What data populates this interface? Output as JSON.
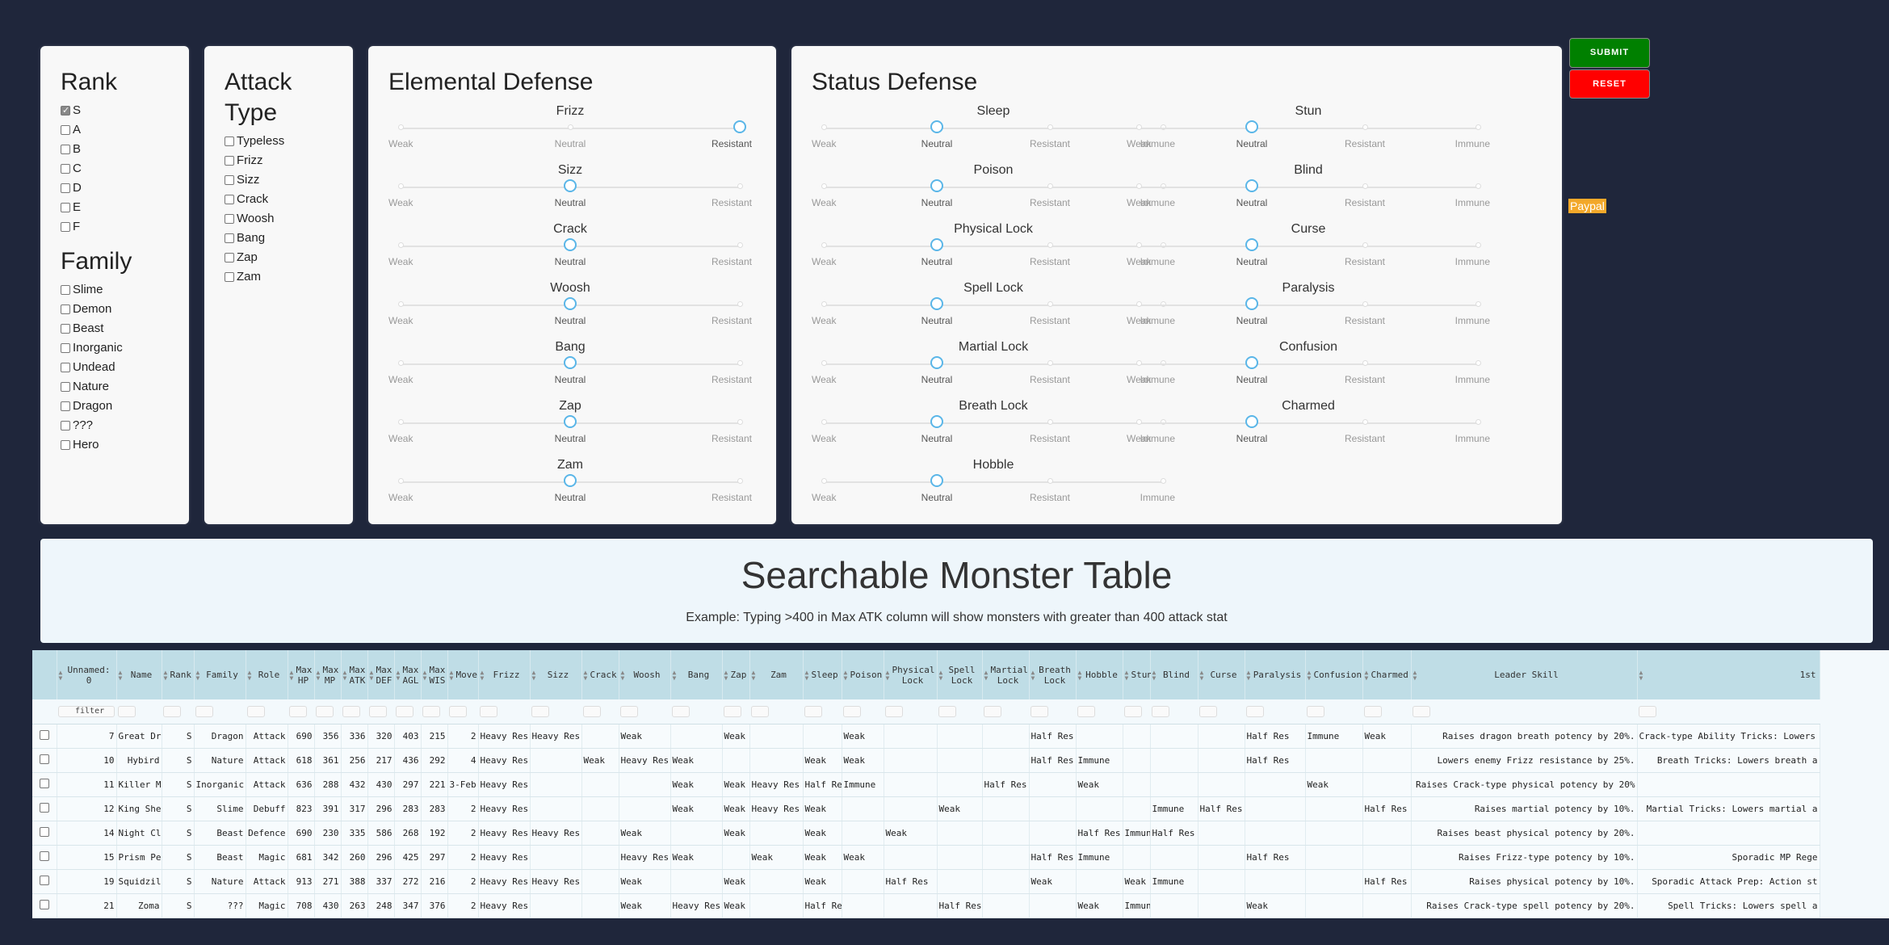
{
  "rank": {
    "title": "Rank",
    "options": [
      {
        "label": "S",
        "checked": true
      },
      {
        "label": "A",
        "checked": false
      },
      {
        "label": "B",
        "checked": false
      },
      {
        "label": "C",
        "checked": false
      },
      {
        "label": "D",
        "checked": false
      },
      {
        "label": "E",
        "checked": false
      },
      {
        "label": "F",
        "checked": false
      }
    ]
  },
  "family": {
    "title": "Family",
    "options": [
      "Slime",
      "Demon",
      "Beast",
      "Inorganic",
      "Undead",
      "Nature",
      "Dragon",
      "???",
      "Hero"
    ]
  },
  "attack_type": {
    "title_line1": "Attack",
    "title_line2": "Type",
    "options": [
      "Typeless",
      "Frizz",
      "Sizz",
      "Crack",
      "Woosh",
      "Bang",
      "Zap",
      "Zam"
    ]
  },
  "elemental_defense": {
    "title": "Elemental Defense",
    "levels": [
      "Weak",
      "Neutral",
      "Resistant"
    ],
    "sliders": [
      {
        "name": "Frizz",
        "value": "Resistant"
      },
      {
        "name": "Sizz",
        "value": "Neutral"
      },
      {
        "name": "Crack",
        "value": "Neutral"
      },
      {
        "name": "Woosh",
        "value": "Neutral"
      },
      {
        "name": "Bang",
        "value": "Neutral"
      },
      {
        "name": "Zap",
        "value": "Neutral"
      },
      {
        "name": "Zam",
        "value": "Neutral"
      }
    ]
  },
  "status_defense": {
    "title": "Status Defense",
    "levels": [
      "Weak",
      "Neutral",
      "Resistant",
      "Immune"
    ],
    "sliders": [
      {
        "name": "Sleep",
        "value": "Neutral"
      },
      {
        "name": "Stun",
        "value": "Neutral"
      },
      {
        "name": "Poison",
        "value": "Neutral"
      },
      {
        "name": "Blind",
        "value": "Neutral"
      },
      {
        "name": "Physical Lock",
        "value": "Neutral"
      },
      {
        "name": "Curse",
        "value": "Neutral"
      },
      {
        "name": "Spell Lock",
        "value": "Neutral"
      },
      {
        "name": "Paralysis",
        "value": "Neutral"
      },
      {
        "name": "Martial Lock",
        "value": "Neutral"
      },
      {
        "name": "Confusion",
        "value": "Neutral"
      },
      {
        "name": "Breath Lock",
        "value": "Neutral"
      },
      {
        "name": "Charmed",
        "value": "Neutral"
      },
      {
        "name": "Hobble",
        "value": "Neutral"
      }
    ]
  },
  "buttons": {
    "submit": "SUBMIT",
    "reset": "RESET",
    "paypal": "Paypal"
  },
  "colors": {
    "submit": "#008000",
    "reset": "#ff0000",
    "background": "#1f263b",
    "header": "#bfdde6",
    "paypal": "#f3a82a"
  },
  "banner": {
    "title": "Searchable Monster Table",
    "subtitle": "Example: Typing >400 in Max ATK column will show monsters with greater than 400 attack stat"
  },
  "table": {
    "filter_placeholder": "filter",
    "columns": [
      "Unnamed: 0",
      "Name",
      "Rank",
      "Family",
      "Role",
      "Max HP",
      "Max MP",
      "Max ATK",
      "Max DEF",
      "Max AGL",
      "Max WIS",
      "Move",
      "Frizz",
      "Sizz",
      "Crack",
      "Woosh",
      "Bang",
      "Zap",
      "Zam",
      "Sleep",
      "Poison",
      "Physical Lock",
      "Spell Lock",
      "Martial Lock",
      "Breath Lock",
      "Hobble",
      "Stun",
      "Blind",
      "Curse",
      "Paralysis",
      "Confusion",
      "Charmed",
      "Leader Skill",
      "1st"
    ],
    "rows": [
      [
        "7",
        "Great Dragon",
        "S",
        "Dragon",
        "Attack",
        "690",
        "356",
        "336",
        "320",
        "403",
        "215",
        "2",
        "Heavy Res",
        "Heavy Res",
        "",
        "Weak",
        "",
        "Weak",
        "",
        "",
        "Weak",
        "",
        "",
        "",
        "Half Res",
        "",
        "",
        "",
        "",
        "Half Res",
        "Immune",
        "Weak",
        "Raises dragon breath potency by 20%.",
        "Crack-type Ability Tricks: Lowers C"
      ],
      [
        "10",
        "Hybird",
        "S",
        "Nature",
        "Attack",
        "618",
        "361",
        "256",
        "217",
        "436",
        "292",
        "4",
        "Heavy Res",
        "",
        "Weak",
        "Heavy Res",
        "Weak",
        "",
        "",
        "Weak",
        "Weak",
        "",
        "",
        "",
        "Half Res",
        "Immune",
        "",
        "",
        "",
        "Half Res",
        "",
        "",
        "Lowers enemy Frizz resistance by 25%.",
        "Breath Tricks: Lowers breath a"
      ],
      [
        "11",
        "Killer Machine",
        "S",
        "Inorganic",
        "Attack",
        "636",
        "288",
        "432",
        "430",
        "297",
        "221",
        "3-Feb",
        "Heavy Res",
        "",
        "",
        "",
        "Weak",
        "Weak",
        "Heavy Res",
        "Half Res",
        "Immune",
        "",
        "",
        "Half Res",
        "",
        "Weak",
        "",
        "",
        "",
        "",
        "Weak",
        "",
        "Raises Crack-type physical potency by 20%",
        ""
      ],
      [
        "12",
        "King She-Slime",
        "S",
        "Slime",
        "Debuff",
        "823",
        "391",
        "317",
        "296",
        "283",
        "283",
        "2",
        "Heavy Res",
        "",
        "",
        "",
        "Weak",
        "Weak",
        "Heavy Res",
        "Weak",
        "",
        "",
        "Weak",
        "",
        "",
        "",
        "",
        "Immune",
        "Half Res",
        "",
        "",
        "Half Res",
        "Raises martial potency by 10%.",
        "Martial Tricks: Lowers martial a"
      ],
      [
        "14",
        "Night Clubber",
        "S",
        "Beast",
        "Defence",
        "690",
        "230",
        "335",
        "586",
        "268",
        "192",
        "2",
        "Heavy Res",
        "Heavy Res",
        "",
        "Weak",
        "",
        "Weak",
        "",
        "Weak",
        "",
        "Weak",
        "",
        "",
        "",
        "Half Res",
        "Immune",
        "Half Res",
        "",
        "",
        "",
        "",
        "Raises beast physical potency by 20%.",
        ""
      ],
      [
        "15",
        "Prism Peacock",
        "S",
        "Beast",
        "Magic",
        "681",
        "342",
        "260",
        "296",
        "425",
        "297",
        "2",
        "Heavy Res",
        "",
        "",
        "Heavy Res",
        "Weak",
        "",
        "Weak",
        "Weak",
        "Weak",
        "",
        "",
        "",
        "Half Res",
        "Immune",
        "",
        "",
        "",
        "Half Res",
        "",
        "",
        "Raises Frizz-type potency by 10%.",
        "Sporadic MP Rege"
      ],
      [
        "19",
        "Squidzilla",
        "S",
        "Nature",
        "Attack",
        "913",
        "271",
        "388",
        "337",
        "272",
        "216",
        "2",
        "Heavy Res",
        "Heavy Res",
        "",
        "Weak",
        "",
        "Weak",
        "",
        "Weak",
        "",
        "Half Res",
        "",
        "",
        "Weak",
        "",
        "Weak",
        "Immune",
        "",
        "",
        "",
        "Half Res",
        "Raises physical potency by 10%.",
        "Sporadic Attack Prep: Action st"
      ],
      [
        "21",
        "Zoma",
        "S",
        "???",
        "Magic",
        "708",
        "430",
        "263",
        "248",
        "347",
        "376",
        "2",
        "Heavy Res",
        "",
        "",
        "Weak",
        "Heavy Res",
        "Weak",
        "",
        "Half Res",
        "",
        "",
        "Half Res",
        "",
        "",
        "Weak",
        "Immune",
        "",
        "",
        "Weak",
        "",
        "",
        "Raises Crack-type spell potency by 20%.",
        "Spell Tricks: Lowers spell a"
      ]
    ]
  }
}
